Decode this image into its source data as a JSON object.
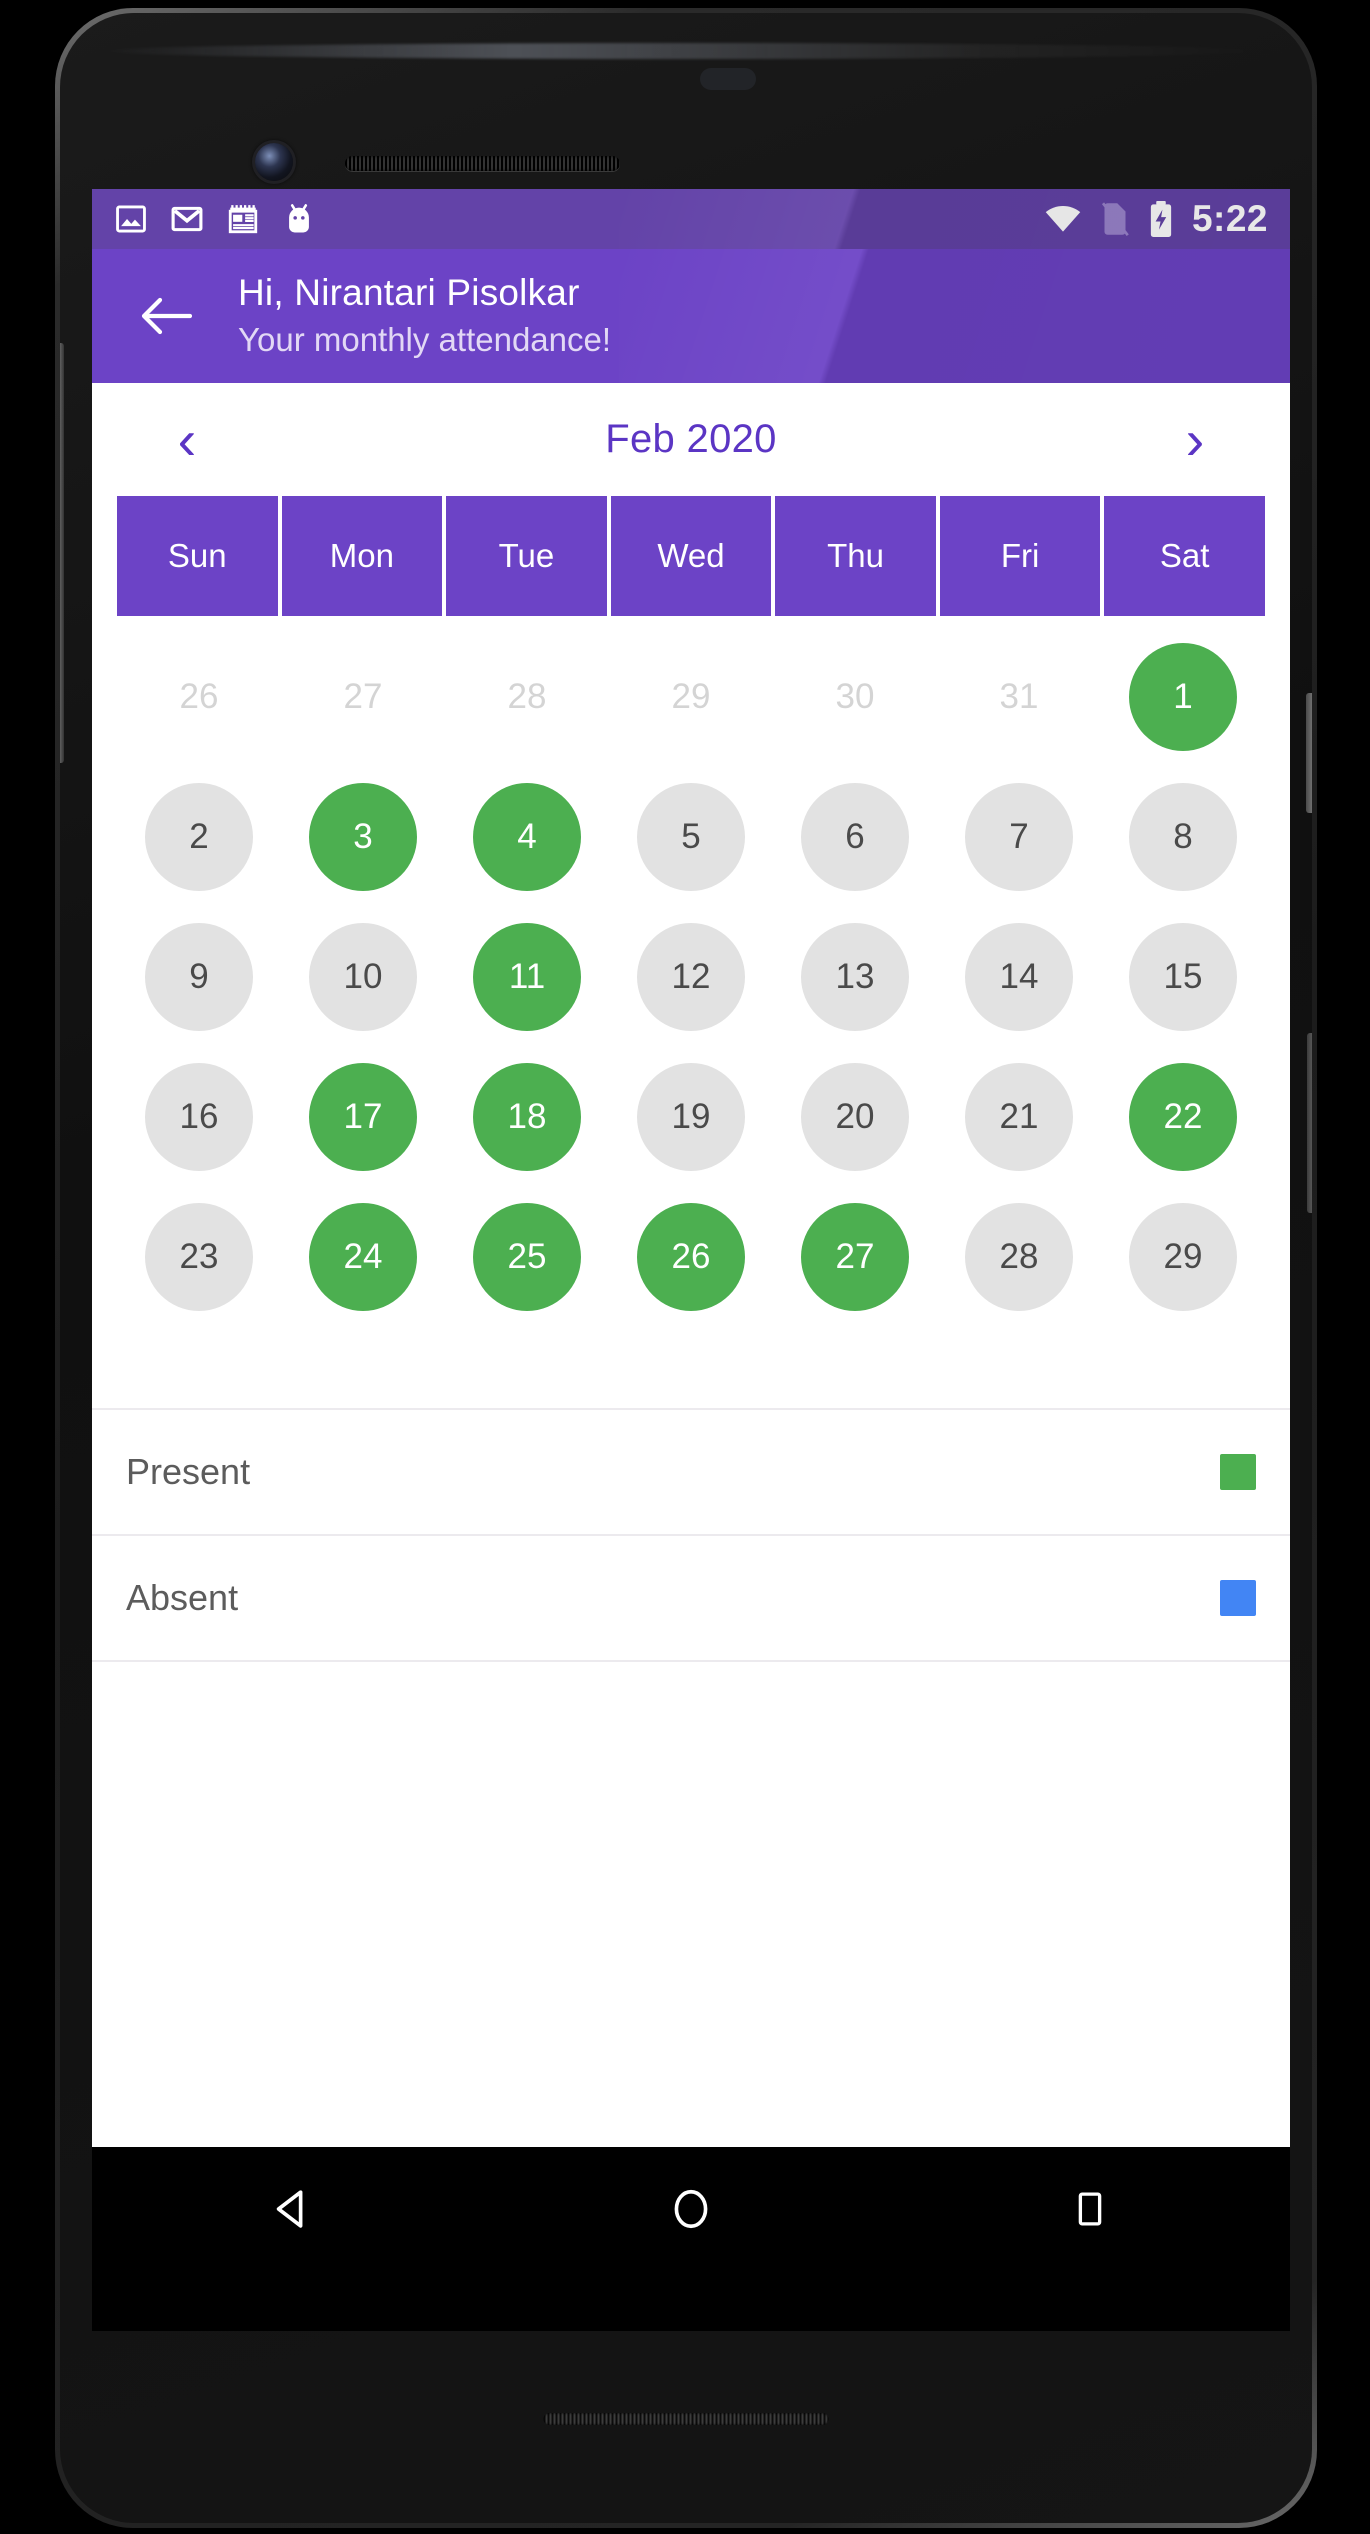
{
  "status_bar": {
    "time": "5:22",
    "left_icons": [
      "image-icon",
      "gmail-icon",
      "news-icon",
      "android-icon"
    ],
    "right_icons": [
      "wifi-icon",
      "no-sim-icon",
      "battery-charging-icon"
    ],
    "background_color": "#6343a8"
  },
  "app_bar": {
    "back_icon": "back-arrow-icon",
    "title": "Hi, Nirantari Pisolkar",
    "subtitle": "Your monthly attendance!",
    "background_color": "#6c43c6"
  },
  "month_nav": {
    "prev_icon": "chevron-left-icon",
    "prev_label": "‹",
    "month_label": "Feb 2020",
    "next_icon": "chevron-right-icon",
    "next_label": "›",
    "accent_color": "#5b35c4"
  },
  "calendar": {
    "weekdays": [
      "Sun",
      "Mon",
      "Tue",
      "Wed",
      "Thu",
      "Fri",
      "Sat"
    ],
    "present_color": "#4CAF50",
    "absent_color": "#e2e2e2",
    "days": [
      {
        "label": "26",
        "state": "other"
      },
      {
        "label": "27",
        "state": "other"
      },
      {
        "label": "28",
        "state": "other"
      },
      {
        "label": "29",
        "state": "other"
      },
      {
        "label": "30",
        "state": "other"
      },
      {
        "label": "31",
        "state": "other"
      },
      {
        "label": "1",
        "state": "present"
      },
      {
        "label": "2",
        "state": "absent"
      },
      {
        "label": "3",
        "state": "present"
      },
      {
        "label": "4",
        "state": "present"
      },
      {
        "label": "5",
        "state": "absent"
      },
      {
        "label": "6",
        "state": "absent"
      },
      {
        "label": "7",
        "state": "absent"
      },
      {
        "label": "8",
        "state": "absent"
      },
      {
        "label": "9",
        "state": "absent"
      },
      {
        "label": "10",
        "state": "absent"
      },
      {
        "label": "11",
        "state": "present"
      },
      {
        "label": "12",
        "state": "absent"
      },
      {
        "label": "13",
        "state": "absent"
      },
      {
        "label": "14",
        "state": "absent"
      },
      {
        "label": "15",
        "state": "absent"
      },
      {
        "label": "16",
        "state": "absent"
      },
      {
        "label": "17",
        "state": "present"
      },
      {
        "label": "18",
        "state": "present"
      },
      {
        "label": "19",
        "state": "absent"
      },
      {
        "label": "20",
        "state": "absent"
      },
      {
        "label": "21",
        "state": "absent"
      },
      {
        "label": "22",
        "state": "present"
      },
      {
        "label": "23",
        "state": "absent"
      },
      {
        "label": "24",
        "state": "present"
      },
      {
        "label": "25",
        "state": "present"
      },
      {
        "label": "26",
        "state": "present"
      },
      {
        "label": "27",
        "state": "present"
      },
      {
        "label": "28",
        "state": "absent"
      },
      {
        "label": "29",
        "state": "absent"
      }
    ]
  },
  "legend": [
    {
      "label": "Present",
      "color": "#4CAF50"
    },
    {
      "label": "Absent",
      "color": "#4285F4"
    }
  ],
  "nav_bar": {
    "back_icon": "nav-back-triangle-icon",
    "home_icon": "nav-home-circle-icon",
    "recents_icon": "nav-recents-square-icon"
  }
}
